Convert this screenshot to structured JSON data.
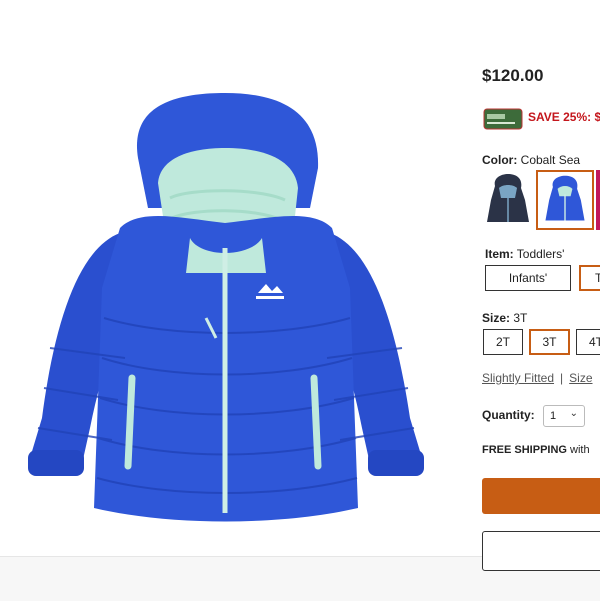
{
  "product": {
    "price": "$120.00",
    "promo_text": "SAVE 25%: $",
    "color_label": "Color:",
    "color_value": "Cobalt Sea",
    "item_label": "Item:",
    "item_value": "Toddlers'",
    "item_options": [
      "Infants'",
      "T"
    ],
    "size_label": "Size:",
    "size_value": "3T",
    "size_options": [
      "2T",
      "3T",
      "4T"
    ],
    "fit_link": "Slightly Fitted",
    "separator": "|",
    "size_link": "Size",
    "quantity_label": "Quantity:",
    "quantity_value": "1",
    "shipping_bold": "FREE SHIPPING",
    "shipping_rest": " with"
  },
  "icons": {
    "jacket_image": "jacket-photo",
    "card": "credit-card-icon",
    "select_chevron": "chevron-down-icon"
  },
  "colors": {
    "accent": "#c75d14",
    "promo": "#c4161c",
    "jacket": "#2f57d8",
    "trim": "#bfe9dc"
  }
}
